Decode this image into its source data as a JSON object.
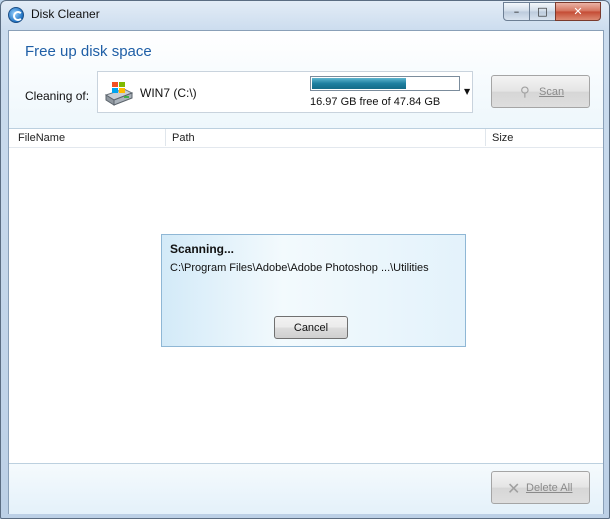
{
  "window": {
    "title": "Disk Cleaner",
    "minimize_glyph": "–",
    "maximize_glyph": "□",
    "close_glyph": "✕"
  },
  "header": {
    "heading": "Free up disk space",
    "cleaning_label": "Cleaning of:",
    "drive": {
      "name": "WIN7 (C:\\)",
      "free_text": "16.97 GB free of 47.84 GB",
      "used_fraction": 0.645,
      "dropdown_glyph": "▼"
    },
    "scan_button": {
      "label": "Scan",
      "icon": "magnifier-icon",
      "enabled": false
    }
  },
  "table": {
    "columns": [
      "FileName",
      "Path",
      "Size"
    ],
    "rows": []
  },
  "dialog": {
    "title": "Scanning...",
    "path": "C:\\Program Files\\Adobe\\Adobe Photoshop ...\\Utilities",
    "cancel_label": "Cancel"
  },
  "footer": {
    "delete_button": {
      "label": "Delete All",
      "icon": "x-icon",
      "enabled": false
    }
  },
  "colors": {
    "accent": "#1f5fa6",
    "usage_fill": "#1e7fa0",
    "disabled_text": "#8a8a8a"
  }
}
